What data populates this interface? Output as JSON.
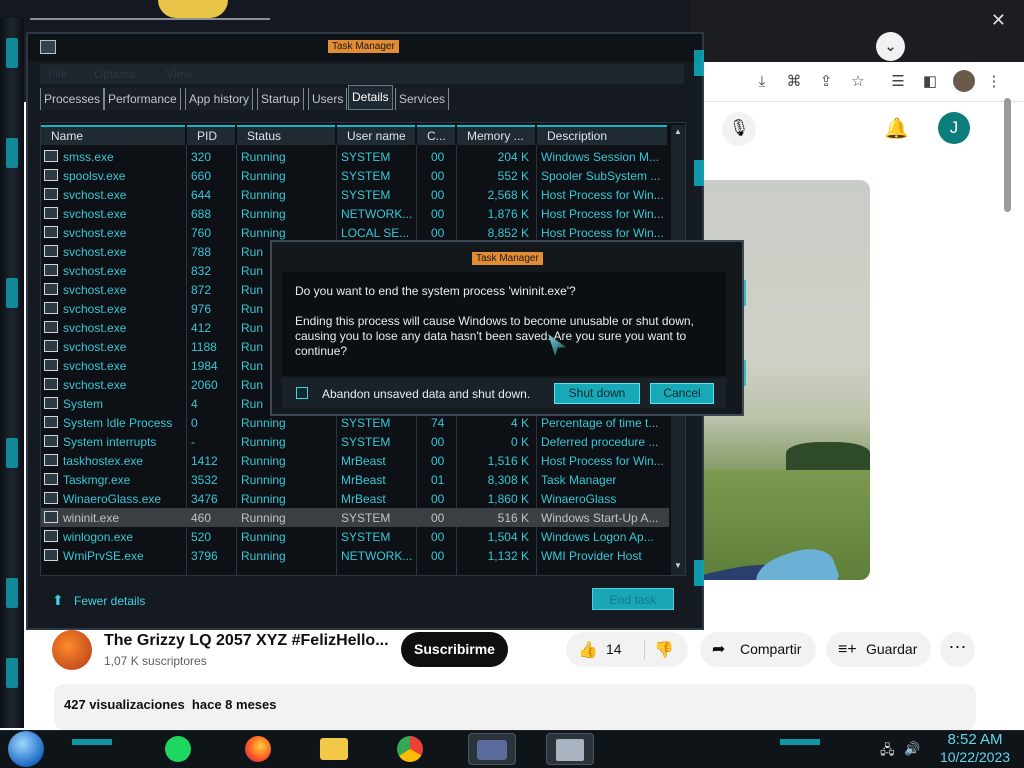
{
  "browser": {
    "title_collapse_icon": "chevron-down-icon",
    "close_icon": "close-icon",
    "toolbar_icons": [
      "download-icon",
      "translate-icon",
      "share-icon",
      "star-icon",
      "playlist-icon",
      "sidebar-icon",
      "profile-avatar",
      "more-icon"
    ],
    "video": {
      "title": "The Grizzy LQ 2057 XYZ #FelizHello...",
      "subscribers": "1,07 K suscriptores",
      "subscribe_label": "Suscribirme",
      "likes": "14",
      "share_label": "Compartir",
      "save_label": "Guardar",
      "views": "427 visualizaciones",
      "age": "hace 8 meses"
    },
    "user_initial": "J"
  },
  "task_manager": {
    "title": "Task Manager",
    "menu": [
      "File",
      "Options",
      "View"
    ],
    "tabs": [
      "Processes",
      "Performance",
      "App history",
      "Startup",
      "Users",
      "Details",
      "Services"
    ],
    "active_tab": "Details",
    "columns": [
      "Name",
      "PID",
      "Status",
      "User name",
      "C...",
      "Memory ...",
      "Description"
    ],
    "rows": [
      {
        "name": "smss.exe",
        "pid": "320",
        "status": "Running",
        "user": "SYSTEM",
        "cpu": "00",
        "mem": "204 K",
        "desc": "Windows Session M..."
      },
      {
        "name": "spoolsv.exe",
        "pid": "660",
        "status": "Running",
        "user": "SYSTEM",
        "cpu": "00",
        "mem": "552 K",
        "desc": "Spooler SubSystem ..."
      },
      {
        "name": "svchost.exe",
        "pid": "644",
        "status": "Running",
        "user": "SYSTEM",
        "cpu": "00",
        "mem": "2,568 K",
        "desc": "Host Process for Win..."
      },
      {
        "name": "svchost.exe",
        "pid": "688",
        "status": "Running",
        "user": "NETWORK...",
        "cpu": "00",
        "mem": "1,876 K",
        "desc": "Host Process for Win..."
      },
      {
        "name": "svchost.exe",
        "pid": "760",
        "status": "Running",
        "user": "LOCAL SE...",
        "cpu": "00",
        "mem": "8,852 K",
        "desc": "Host Process for Win..."
      },
      {
        "name": "svchost.exe",
        "pid": "788",
        "status": "Run",
        "user": "",
        "cpu": "",
        "mem": "",
        "desc": ""
      },
      {
        "name": "svchost.exe",
        "pid": "832",
        "status": "Run",
        "user": "",
        "cpu": "",
        "mem": "",
        "desc": ""
      },
      {
        "name": "svchost.exe",
        "pid": "872",
        "status": "Run",
        "user": "",
        "cpu": "",
        "mem": "",
        "desc": ""
      },
      {
        "name": "svchost.exe",
        "pid": "976",
        "status": "Run",
        "user": "",
        "cpu": "",
        "mem": "",
        "desc": ""
      },
      {
        "name": "svchost.exe",
        "pid": "412",
        "status": "Run",
        "user": "",
        "cpu": "",
        "mem": "",
        "desc": ""
      },
      {
        "name": "svchost.exe",
        "pid": "1188",
        "status": "Run",
        "user": "",
        "cpu": "",
        "mem": "",
        "desc": ""
      },
      {
        "name": "svchost.exe",
        "pid": "1984",
        "status": "Run",
        "user": "",
        "cpu": "",
        "mem": "",
        "desc": ""
      },
      {
        "name": "svchost.exe",
        "pid": "2060",
        "status": "Run",
        "user": "",
        "cpu": "",
        "mem": "",
        "desc": ""
      },
      {
        "name": "System",
        "pid": "4",
        "status": "Run",
        "user": "",
        "cpu": "",
        "mem": "",
        "desc": ""
      },
      {
        "name": "System Idle Process",
        "pid": "0",
        "status": "Running",
        "user": "SYSTEM",
        "cpu": "74",
        "mem": "4 K",
        "desc": "Percentage of time t..."
      },
      {
        "name": "System interrupts",
        "pid": "-",
        "status": "Running",
        "user": "SYSTEM",
        "cpu": "00",
        "mem": "0 K",
        "desc": "Deferred procedure ..."
      },
      {
        "name": "taskhostex.exe",
        "pid": "1412",
        "status": "Running",
        "user": "MrBeast",
        "cpu": "00",
        "mem": "1,516 K",
        "desc": "Host Process for Win..."
      },
      {
        "name": "Taskmgr.exe",
        "pid": "3532",
        "status": "Running",
        "user": "MrBeast",
        "cpu": "01",
        "mem": "8,308 K",
        "desc": "Task Manager"
      },
      {
        "name": "WinaeroGlass.exe",
        "pid": "3476",
        "status": "Running",
        "user": "MrBeast",
        "cpu": "00",
        "mem": "1,860 K",
        "desc": "WinaeroGlass"
      },
      {
        "name": "wininit.exe",
        "pid": "460",
        "status": "Running",
        "user": "SYSTEM",
        "cpu": "00",
        "mem": "516 K",
        "desc": "Windows Start-Up A..."
      },
      {
        "name": "winlogon.exe",
        "pid": "520",
        "status": "Running",
        "user": "SYSTEM",
        "cpu": "00",
        "mem": "1,504 K",
        "desc": "Windows Logon Ap..."
      },
      {
        "name": "WmiPrvSE.exe",
        "pid": "3796",
        "status": "Running",
        "user": "NETWORK...",
        "cpu": "00",
        "mem": "1,132 K",
        "desc": "WMI Provider Host"
      }
    ],
    "selected_row": "wininit.exe",
    "fewer_details": "Fewer details",
    "end_task": "End task"
  },
  "dialog": {
    "title": "Task Manager",
    "question": "Do you want to end the system process 'wininit.exe'?",
    "message": "Ending this process will cause Windows to become unusable or shut down, causing you to lose any data hasn't been saved. Are you sure you want to continue?",
    "checkbox_label": "Abandon unsaved data and shut down.",
    "shutdown_label": "Shut down",
    "cancel_label": "Cancel"
  },
  "taskbar": {
    "time": "8:52 AM",
    "date": "10/22/2023",
    "apps": [
      "notes-app-icon",
      "firefox-icon",
      "file-explorer-icon",
      "chrome-icon",
      "settings-panel-icon",
      "task-manager-icon"
    ]
  },
  "colors": {
    "accent": "#0fb7c9",
    "title_badge": "#e28d34",
    "link": "#38c6d6"
  }
}
